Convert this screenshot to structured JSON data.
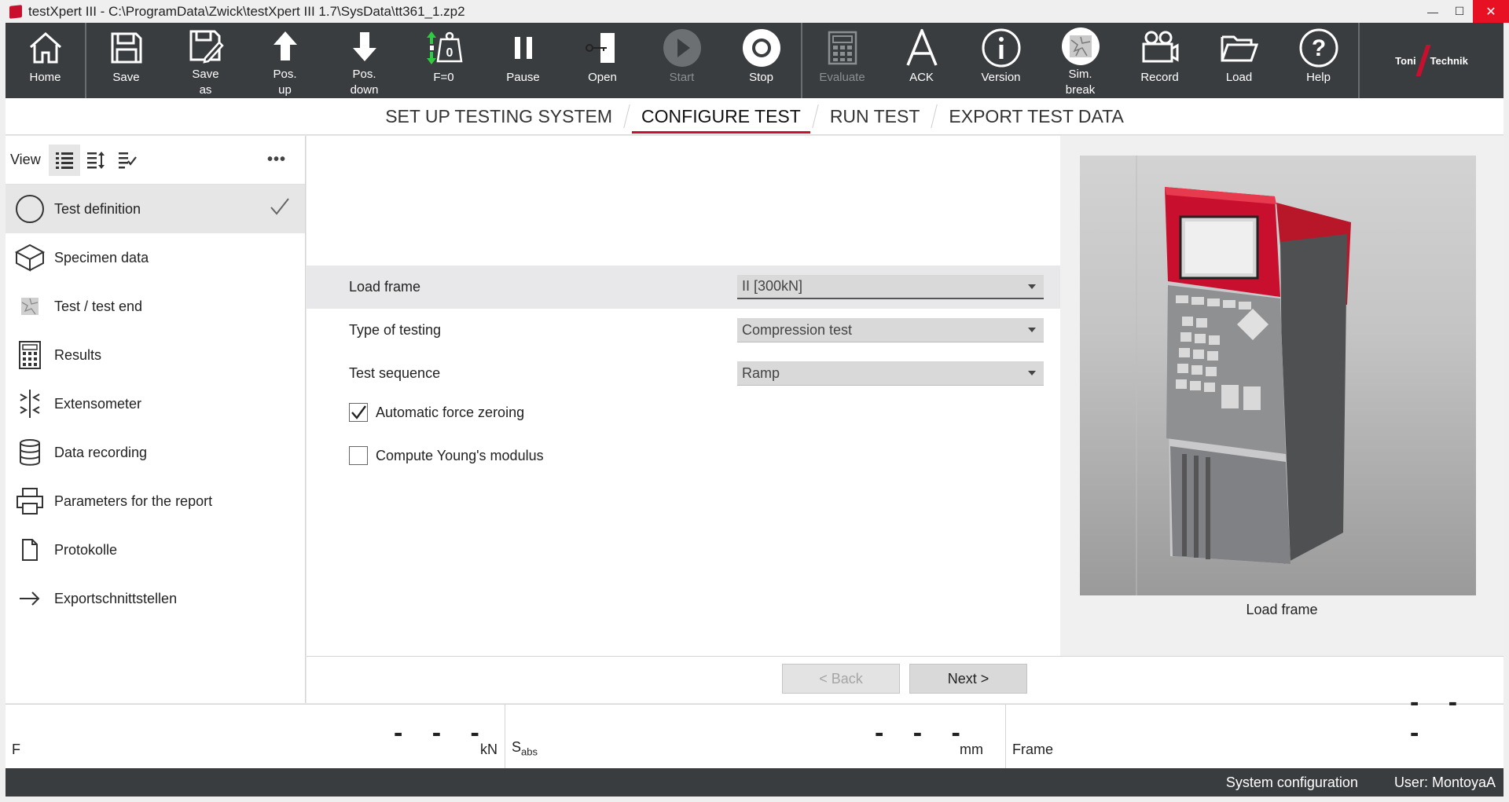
{
  "window": {
    "title": "testXpert III - C:\\ProgramData\\Zwick\\testXpert III 1.7\\SysData\\tt361_1.zp2",
    "minimize": "—",
    "maximize": "☐",
    "close": "✕"
  },
  "toolbar": {
    "home": "Home",
    "save": "Save",
    "save_as": "Save\nas",
    "pos_up": "Pos.\nup",
    "pos_down": "Pos.\ndown",
    "f0": "F=0",
    "pause": "Pause",
    "open": "Open",
    "start": "Start",
    "stop": "Stop",
    "evaluate": "Evaluate",
    "ack": "ACK",
    "version": "Version",
    "sim_break": "Sim.\nbreak",
    "record": "Record",
    "load": "Load",
    "help": "Help",
    "logo_left": "Toni",
    "logo_right": "Technik"
  },
  "tabs": {
    "setup": "SET UP TESTING SYSTEM",
    "configure": "CONFIGURE TEST",
    "run": "RUN TEST",
    "export": "EXPORT TEST DATA"
  },
  "sidebar": {
    "view_label": "View",
    "more": "•••",
    "items": [
      {
        "label": "Test definition"
      },
      {
        "label": "Specimen data"
      },
      {
        "label": "Test / test end"
      },
      {
        "label": "Results"
      },
      {
        "label": "Extensometer"
      },
      {
        "label": "Data recording"
      },
      {
        "label": "Parameters for the report"
      },
      {
        "label": "Protokolle"
      },
      {
        "label": "Exportschnittstellen"
      }
    ]
  },
  "form": {
    "load_frame_label": "Load frame",
    "load_frame_value": "II [300kN]",
    "type_label": "Type of testing",
    "type_value": "Compression test",
    "sequence_label": "Test sequence",
    "sequence_value": "Ramp",
    "auto_zero_label": "Automatic force zeroing",
    "auto_zero_checked": true,
    "youngs_label": "Compute Young's modulus",
    "youngs_checked": false
  },
  "image_panel": {
    "caption": "Load frame"
  },
  "nav_buttons": {
    "back": "< Back",
    "next": "Next >"
  },
  "readouts": {
    "force_label": "F",
    "force_value": "- - -",
    "force_unit": "kN",
    "sabs_label": "S",
    "sabs_sub": "abs",
    "sabs_value": "- - -",
    "sabs_unit": "mm",
    "frame_label": "Frame",
    "frame_value": "- - -"
  },
  "status": {
    "config": "System configuration",
    "user": "User: MontoyaA"
  },
  "colors": {
    "accent": "#c8102e",
    "toolbar": "#3a3d40",
    "active_row": "#e6e6e6"
  }
}
